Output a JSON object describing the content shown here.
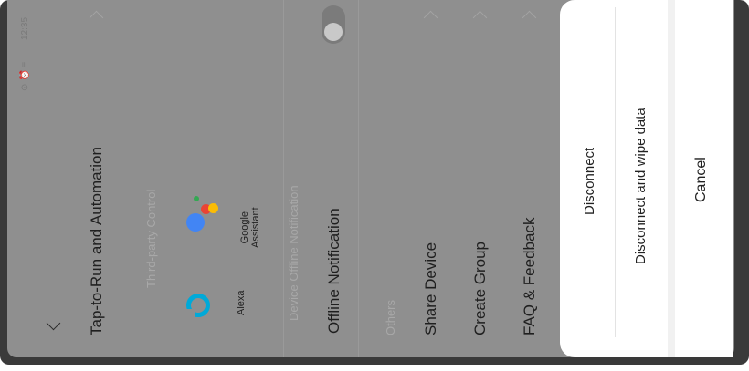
{
  "status_bar": {
    "time": "12:35",
    "indicators": "⊙ ⏰ ≡"
  },
  "device_settings": {
    "back_icon": "chevron-down-icon",
    "tap_to_run": "Tap-to-Run and Automation",
    "third_party_label": "Third-party Control",
    "alexa_label": "Alexa",
    "google_label": "Google\nAssistant",
    "offline_section_label": "Device Offline Notification",
    "offline_notification": "Offline Notification",
    "others_label": "Others",
    "share_device": "Share Device",
    "create_group": "Create Group",
    "faq_feedback": "FAQ & Feedback"
  },
  "action_sheet": {
    "disconnect": "Disconnect",
    "disconnect_wipe": "Disconnect and wipe data",
    "cancel": "Cancel"
  },
  "colors": {
    "alexa": "#00a9d8",
    "google_blue": "#4285f4",
    "google_red": "#ea4335",
    "google_yellow": "#fbbc05",
    "google_green": "#34a853"
  }
}
